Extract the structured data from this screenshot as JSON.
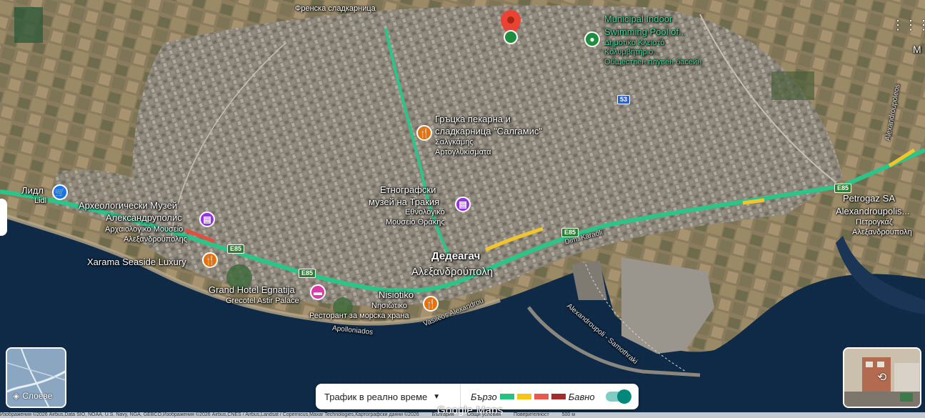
{
  "labels": {
    "top_shop": "Френска сладкарница",
    "pool_en1": "Municipal Indoor",
    "pool_en2": "Swimming Pool of...",
    "pool_gr1": "Δημοτικό Κλειστό",
    "pool_gr2": "Κολυμβητήριο...",
    "pool_bg": "Обществен плувен басейн",
    "bakery1": "Гръцка пекарна и",
    "bakery2": "сладкарница \"Салгамис\"",
    "bakery_gr1": "Σαλγκάμης",
    "bakery_gr2": "Αρτογλυκίσματα",
    "museum1": "Етнографски",
    "museum2": "музей на Тракия",
    "museum_gr1": "Εθνολογικό",
    "museum_gr2": "Μουσείο Θράκης",
    "city_bg": "Дедеагач",
    "city_gr": "Αλεξανδρούπολη",
    "lidl_bg": "Лидл",
    "lidl_lat": "Lidl",
    "arch1": "Археологически Музей",
    "arch2": "Александруполис",
    "arch_gr1": "Αρχαιολογικό Μουσείο",
    "arch_gr2": "Αλεξανδρούπολης",
    "xarama": "Xarama Seaside Luxury",
    "grand": "Grand Hotel Egnatija",
    "grecotel": "Grecotel Astir Palace",
    "nisiotiko": "Nisiotiko",
    "nisiotiko_gr": "Νησιώτικο",
    "rest_bg": "Ресторант за морска храна",
    "petrogaz1": "Petrogaz SA",
    "petrogaz2": "Alexandroupolis...",
    "petrogaz_gr1": "Πετρογκάζ",
    "petrogaz_gr2": "Αλεξανδρούπολη",
    "road_apolloniados": "Apolloniados",
    "road_vasileos": "Vasileos Alexandrou",
    "road_karaoli": "Dim. Karaoli",
    "road_samothraki": "Alexandroupoli - Samothraki",
    "road_alexandroupoleos": "Alexandroupoleos",
    "edge_m": "M"
  },
  "shields": {
    "e85": "E85",
    "r53": "53"
  },
  "layers": {
    "label": "Слоеве"
  },
  "traffic": {
    "selector": "Трафик в реално време",
    "fast": "Бързо",
    "slow": "Бавно",
    "colors": [
      "#26c281",
      "#f5c518",
      "#e8584f",
      "#a52a2a"
    ]
  },
  "branding": {
    "logo": "Google Maps"
  },
  "attribution": {
    "imagery": "Изображения ©2026 Airbus,Data SIO, NOAA, U.S. Navy, NGA, GEBCO,Изображения ©2026 Airbus,CNES / Airbus,Landsat / Copernicus,Maxar Technologies,Картографски данни ©2026",
    "country": "България",
    "terms": "Общи условия",
    "privacy": "Поверителност",
    "scale": "500 м"
  }
}
